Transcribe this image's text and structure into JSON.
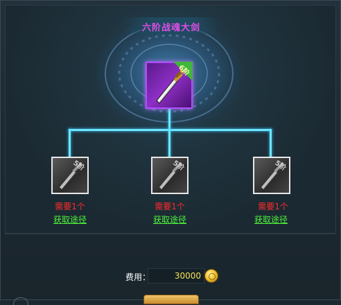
{
  "dialog": {
    "title": "六阶战魂大剑",
    "main_item": {
      "rank_badge": "6阶",
      "name": "六阶战魂大剑"
    },
    "materials": [
      {
        "need_text": "需要1个",
        "get_link": "获取途径",
        "rank_badge": "5阶"
      },
      {
        "need_text": "需要1个",
        "get_link": "获取途径",
        "rank_badge": "5阶"
      },
      {
        "need_text": "需要1个",
        "get_link": "获取途径",
        "rank_badge": "5阶"
      }
    ],
    "cost": {
      "label": "费用：",
      "value": "30000",
      "icon": "gold-coin-icon"
    }
  },
  "colors": {
    "title": "#e04de8",
    "need": "#ff2a2a",
    "link": "#4ff03c",
    "cost_value": "#f5e15a",
    "connector": "#6fe6ff",
    "main_border": "#b050ff"
  }
}
